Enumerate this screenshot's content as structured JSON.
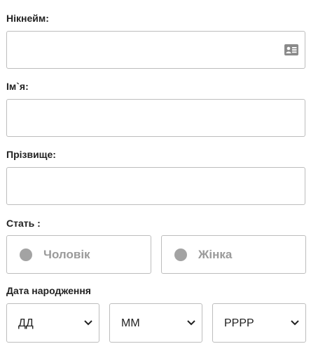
{
  "form": {
    "nickname": {
      "label": "Нікнейм:",
      "value": "",
      "placeholder": "",
      "icon": "contact-card-icon"
    },
    "first_name": {
      "label": "Ім`я:",
      "value": "",
      "placeholder": ""
    },
    "last_name": {
      "label": "Прізвище:",
      "value": "",
      "placeholder": ""
    },
    "gender": {
      "label": "Стать :",
      "options": [
        {
          "label": "Чоловік"
        },
        {
          "label": "Жінка"
        }
      ]
    },
    "birthdate": {
      "label": "Дата народження",
      "day": "ДД",
      "month": "ММ",
      "year": "РРРР"
    }
  },
  "colors": {
    "border": "#bdbdbd",
    "muted_text": "#9a9a9a",
    "radio_dot": "#a3a3a3",
    "icon": "#8a8a8a"
  }
}
